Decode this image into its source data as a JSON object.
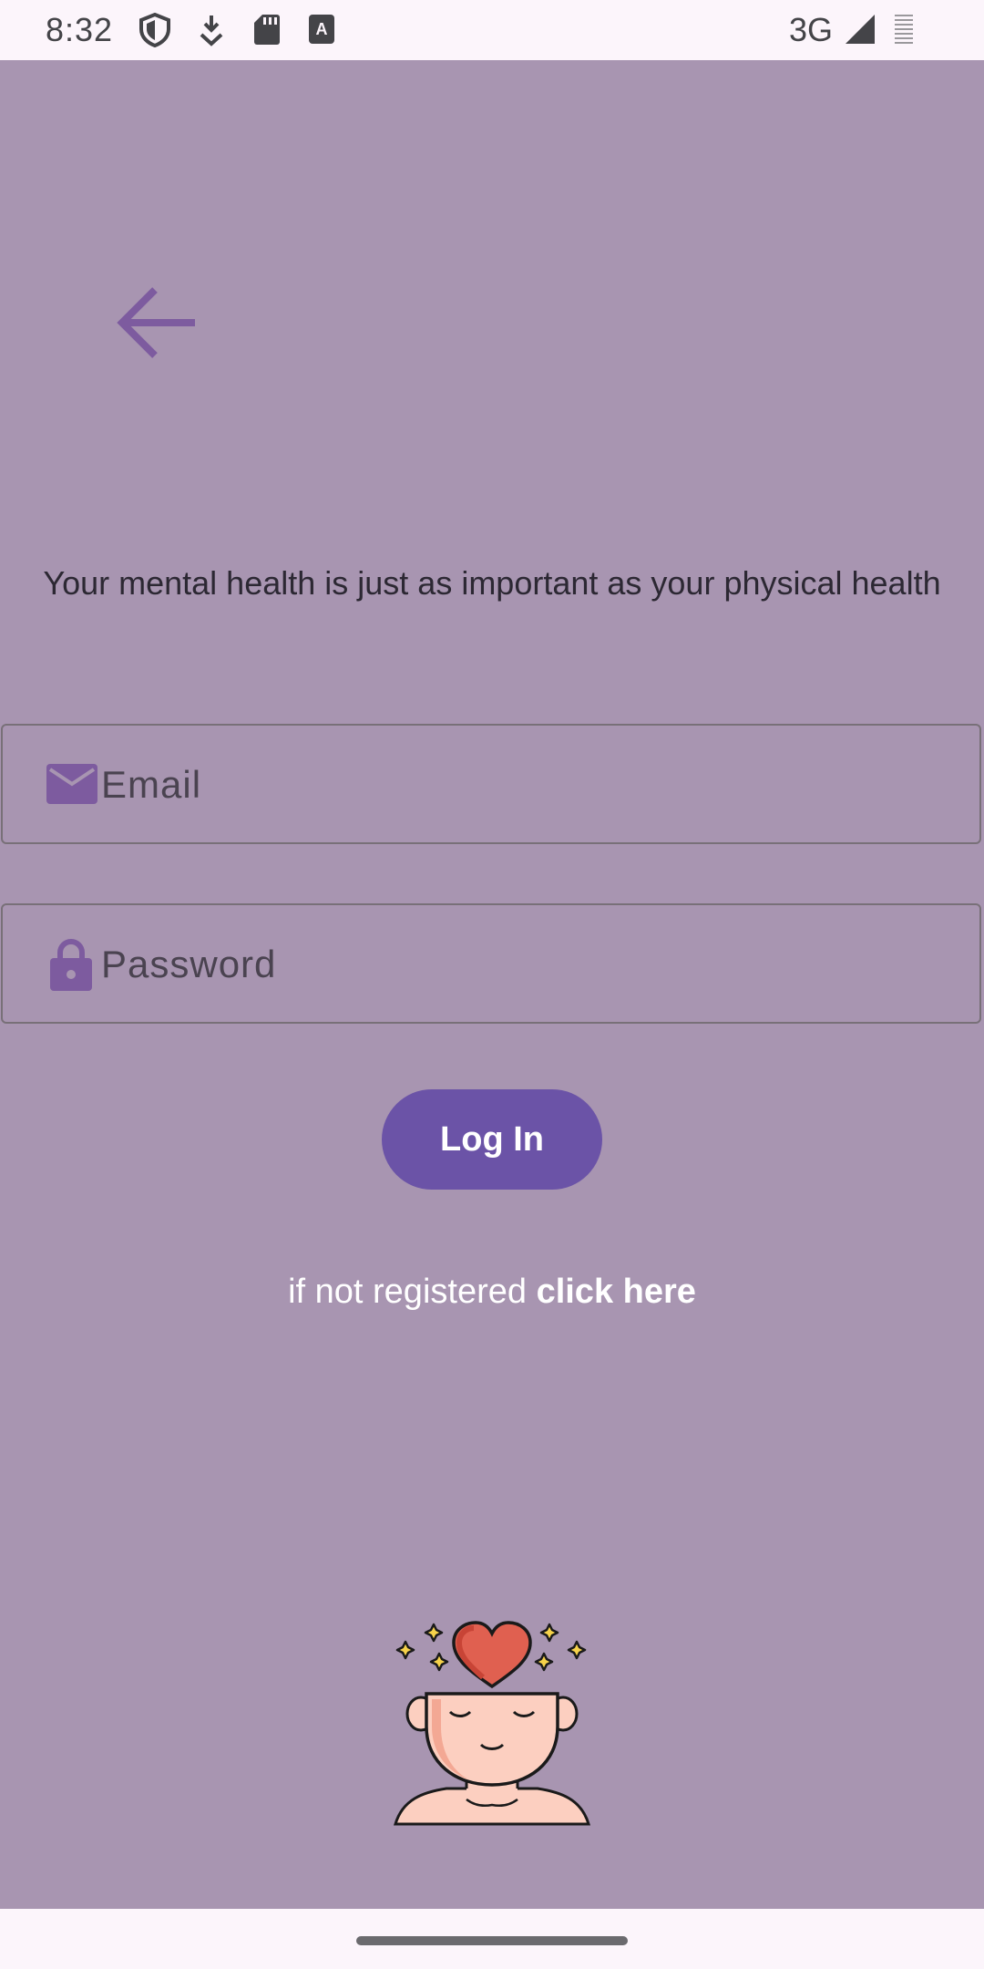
{
  "status_bar": {
    "time": "8:32",
    "network": "3G",
    "icons": [
      "shield-icon",
      "download-icon",
      "sd-card-icon",
      "keyboard-a-icon",
      "signal-icon",
      "battery-icon"
    ]
  },
  "screen": {
    "background_color": "#a895b1",
    "back_icon": "arrow-left-icon",
    "tagline": "Your mental health is just as important as your physical health",
    "email": {
      "placeholder": "Email",
      "value": "",
      "icon": "mail-icon"
    },
    "password": {
      "placeholder": "Password",
      "value": "",
      "icon": "lock-icon"
    },
    "login_label": "Log In",
    "login_color": "#6b53a7",
    "register_prefix": "if not registered ",
    "register_link": "click here",
    "illustration": "mindful-head-heart-illustration"
  }
}
